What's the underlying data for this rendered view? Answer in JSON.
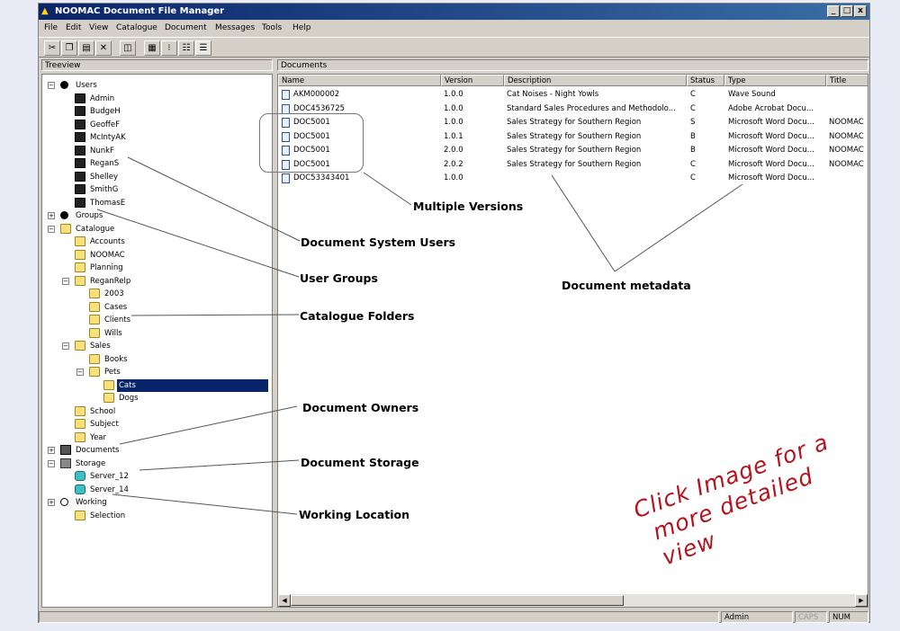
{
  "window": {
    "title": "NOOMAC Document File Manager",
    "minimize": "_",
    "maximize": "□",
    "close": "x"
  },
  "menu": [
    "File",
    "Edit",
    "View",
    "Catalogue",
    "Document",
    "Messages",
    "Tools",
    "Help"
  ],
  "panes": {
    "tree_title": "Treeview",
    "docs_title": "Documents"
  },
  "tree": [
    {
      "label": "Users",
      "icon": "user-group-icon",
      "expander": "−"
    },
    {
      "label": "Admin",
      "icon": "user-icon"
    },
    {
      "label": "BudgeH",
      "icon": "user-icon"
    },
    {
      "label": "GeoffeF",
      "icon": "user-icon"
    },
    {
      "label": "McIntyAK",
      "icon": "user-icon"
    },
    {
      "label": "NunkF",
      "icon": "user-icon"
    },
    {
      "label": "ReganS",
      "icon": "user-icon"
    },
    {
      "label": "Shelley",
      "icon": "user-icon"
    },
    {
      "label": "SmithG",
      "icon": "user-icon"
    },
    {
      "label": "ThomasE",
      "icon": "user-icon"
    },
    {
      "label": "Groups",
      "icon": "group-icon",
      "expander": "+"
    },
    {
      "label": "Catalogue",
      "icon": "folder-icon",
      "expander": "−"
    },
    {
      "label": "Accounts",
      "icon": "folder-icon"
    },
    {
      "label": "NOOMAC",
      "icon": "folder-icon"
    },
    {
      "label": "Planning",
      "icon": "folder-icon"
    },
    {
      "label": "ReganRelp",
      "icon": "folder-icon",
      "expander": "−"
    },
    {
      "label": "2003",
      "icon": "folder-icon"
    },
    {
      "label": "Cases",
      "icon": "folder-icon"
    },
    {
      "label": "Clients",
      "icon": "folder-icon"
    },
    {
      "label": "Wills",
      "icon": "folder-icon"
    },
    {
      "label": "Sales",
      "icon": "folder-icon",
      "expander": "−"
    },
    {
      "label": "Books",
      "icon": "folder-icon"
    },
    {
      "label": "Pets",
      "icon": "folder-icon",
      "expander": "−"
    },
    {
      "label": "Cats",
      "icon": "folder-icon",
      "selected": true
    },
    {
      "label": "Dogs",
      "icon": "folder-icon"
    },
    {
      "label": "School",
      "icon": "folder-icon"
    },
    {
      "label": "Subject",
      "icon": "folder-icon"
    },
    {
      "label": "Year",
      "icon": "folder-icon"
    },
    {
      "label": "Documents",
      "icon": "documents-icon",
      "expander": "+"
    },
    {
      "label": "Storage",
      "icon": "storage-icon",
      "expander": "−"
    },
    {
      "label": "Server_12",
      "icon": "server-icon"
    },
    {
      "label": "Server_14",
      "icon": "server-icon"
    },
    {
      "label": "Working",
      "icon": "key-icon",
      "expander": "+"
    },
    {
      "label": "Selection",
      "icon": "folder-icon"
    }
  ],
  "columns": [
    "Name",
    "Version",
    "Description",
    "Status",
    "Type",
    "Title"
  ],
  "documents": [
    {
      "name": "AKM000002",
      "version": "1.0.0",
      "description": "Cat Noises - Night Yowls",
      "status": "C",
      "type": "Wave Sound",
      "title": ""
    },
    {
      "name": "DOC4536725",
      "version": "1.0.0",
      "description": "Standard Sales Procedures and Methodolo...",
      "status": "C",
      "type": "Adobe Acrobat Docu...",
      "title": ""
    },
    {
      "name": "DOC5001",
      "version": "1.0.0",
      "description": "Sales Strategy for Southern Region",
      "status": "S",
      "type": "Microsoft Word Docu...",
      "title": "NOOMAC"
    },
    {
      "name": "DOC5001",
      "version": "1.0.1",
      "description": "Sales Strategy for Southern Region",
      "status": "B",
      "type": "Microsoft Word Docu...",
      "title": "NOOMAC"
    },
    {
      "name": "DOC5001",
      "version": "2.0.0",
      "description": "Sales Strategy for Southern Region",
      "status": "B",
      "type": "Microsoft Word Docu...",
      "title": "NOOMAC"
    },
    {
      "name": "DOC5001",
      "version": "2.0.2",
      "description": "Sales Strategy for Southern Region",
      "status": "C",
      "type": "Microsoft Word Docu...",
      "title": "NOOMAC"
    },
    {
      "name": "DOC53343401",
      "version": "1.0.0",
      "description": "",
      "status": "C",
      "type": "Microsoft Word Docu...",
      "title": ""
    }
  ],
  "status": {
    "user": "Admin",
    "caps": "CAPS",
    "num": "NUM"
  },
  "callouts": {
    "multiple_versions": "Multiple Versions",
    "system_users": "Document System Users",
    "user_groups": "User Groups",
    "catalogue_folders": "Catalogue Folders",
    "metadata": "Document metadata",
    "owners": "Document Owners",
    "storage": "Document Storage",
    "working": "Working Location"
  },
  "hint": {
    "line1": "Click Image for a",
    "line2": "more detailed view"
  },
  "colors": {
    "hint_red": "#b3141e",
    "titlebar": "#0a246a",
    "selection": "#0a246a"
  }
}
